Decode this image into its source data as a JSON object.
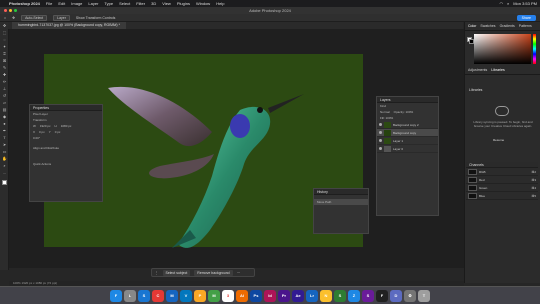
{
  "menubar": {
    "app_name": "Photoshop 2024",
    "items": [
      "File",
      "Edit",
      "Image",
      "Layer",
      "Type",
      "Select",
      "Filter",
      "3D",
      "View",
      "Plugins",
      "Window",
      "Help"
    ],
    "clock": "Mon 3:53 PM"
  },
  "window": {
    "title": "Adobe Photoshop 2024"
  },
  "options": {
    "preset": "Auto-Select",
    "target": "Layer",
    "transform": "Show Transform Controls",
    "share": "Share"
  },
  "document": {
    "tab": "hummingbird-7137037.jpg @ 100% (Background copy, RGB/8#) *"
  },
  "tools": [
    "move",
    "marquee",
    "lasso",
    "wand",
    "crop",
    "frame",
    "eyedropper",
    "heal",
    "brush",
    "stamp",
    "history-brush",
    "eraser",
    "gradient",
    "blur",
    "dodge",
    "pen",
    "type",
    "path-select",
    "shape",
    "hand",
    "zoom",
    "more"
  ],
  "properties": {
    "title": "Properties",
    "kind": "Pixel Layer",
    "section_transform": "Transform",
    "w": "1920 px",
    "h": "1080 px",
    "x": "0 px",
    "y": "0 px",
    "angle": "0.00°",
    "section_align": "Align and Distribute",
    "section_quick": "Quick Actions"
  },
  "layers": {
    "title": "Layers",
    "kind_label": "Kind",
    "mode": "Normal",
    "opacity_label": "Opacity: 100%",
    "fill_label": "Fill: 100%",
    "items": [
      {
        "name": "Background copy 2",
        "color": "#2c4a12"
      },
      {
        "name": "Background copy",
        "color": "#26420f"
      },
      {
        "name": "Layer 1",
        "color": "#2c4a12"
      },
      {
        "name": "Layer 0",
        "color": "#555555"
      }
    ]
  },
  "history": {
    "title": "History",
    "item": "Move Path"
  },
  "contextbar": {
    "select_subject": "Select subject",
    "remove_bg": "Remove background"
  },
  "status": {
    "zoom": "100%",
    "size": "1920 px x 1080 px (72 ppi)"
  },
  "right": {
    "tabs": [
      "Color",
      "Swatches",
      "Gradients",
      "Patterns"
    ],
    "lib_tabs": [
      "Adjustments",
      "Libraries"
    ],
    "lib_title": "Libraries",
    "lib_msg": "Library syncing is paused. To begin, find and browse your Creative Cloud Libraries again.",
    "lib_action": "Resume",
    "channels_title": "Channels",
    "channels": [
      {
        "name": "RGB",
        "key": "⌘2"
      },
      {
        "name": "Red",
        "key": "⌘3"
      },
      {
        "name": "Green",
        "key": "⌘4"
      },
      {
        "name": "Blue",
        "key": "⌘5"
      }
    ]
  },
  "dock": [
    {
      "name": "finder",
      "label": "F",
      "color": "#1e88e5"
    },
    {
      "name": "launchpad",
      "label": "L",
      "color": "#888888"
    },
    {
      "name": "safari",
      "label": "S",
      "color": "#1976d2"
    },
    {
      "name": "chrome",
      "label": "C",
      "color": "#e53935"
    },
    {
      "name": "mail",
      "label": "M",
      "color": "#1565c0"
    },
    {
      "name": "vscode",
      "label": "V",
      "color": "#0277bd"
    },
    {
      "name": "photos",
      "label": "P",
      "color": "#f9a825"
    },
    {
      "name": "messages",
      "label": "M",
      "color": "#43a047"
    },
    {
      "name": "calendar",
      "label": "3",
      "color": "#ffffff"
    },
    {
      "name": "illustrator",
      "label": "Ai",
      "color": "#ef6c00"
    },
    {
      "name": "photoshop",
      "label": "Ps",
      "color": "#0d47a1"
    },
    {
      "name": "indesign",
      "label": "Id",
      "color": "#ad1457"
    },
    {
      "name": "premiere",
      "label": "Pr",
      "color": "#4a148c"
    },
    {
      "name": "aftereffects",
      "label": "Ae",
      "color": "#311b92"
    },
    {
      "name": "lightroom",
      "label": "Lr",
      "color": "#1565c0"
    },
    {
      "name": "notes",
      "label": "N",
      "color": "#fbc02d"
    },
    {
      "name": "spotify",
      "label": "S",
      "color": "#2e7d32"
    },
    {
      "name": "zoom",
      "label": "Z",
      "color": "#1e88e5"
    },
    {
      "name": "slack",
      "label": "S",
      "color": "#6a1b9a"
    },
    {
      "name": "figma",
      "label": "F",
      "color": "#212121"
    },
    {
      "name": "discord",
      "label": "D",
      "color": "#5c6bc0"
    },
    {
      "name": "settings",
      "label": "⚙",
      "color": "#757575"
    },
    {
      "name": "trash",
      "label": "T",
      "color": "#9e9e9e"
    }
  ]
}
